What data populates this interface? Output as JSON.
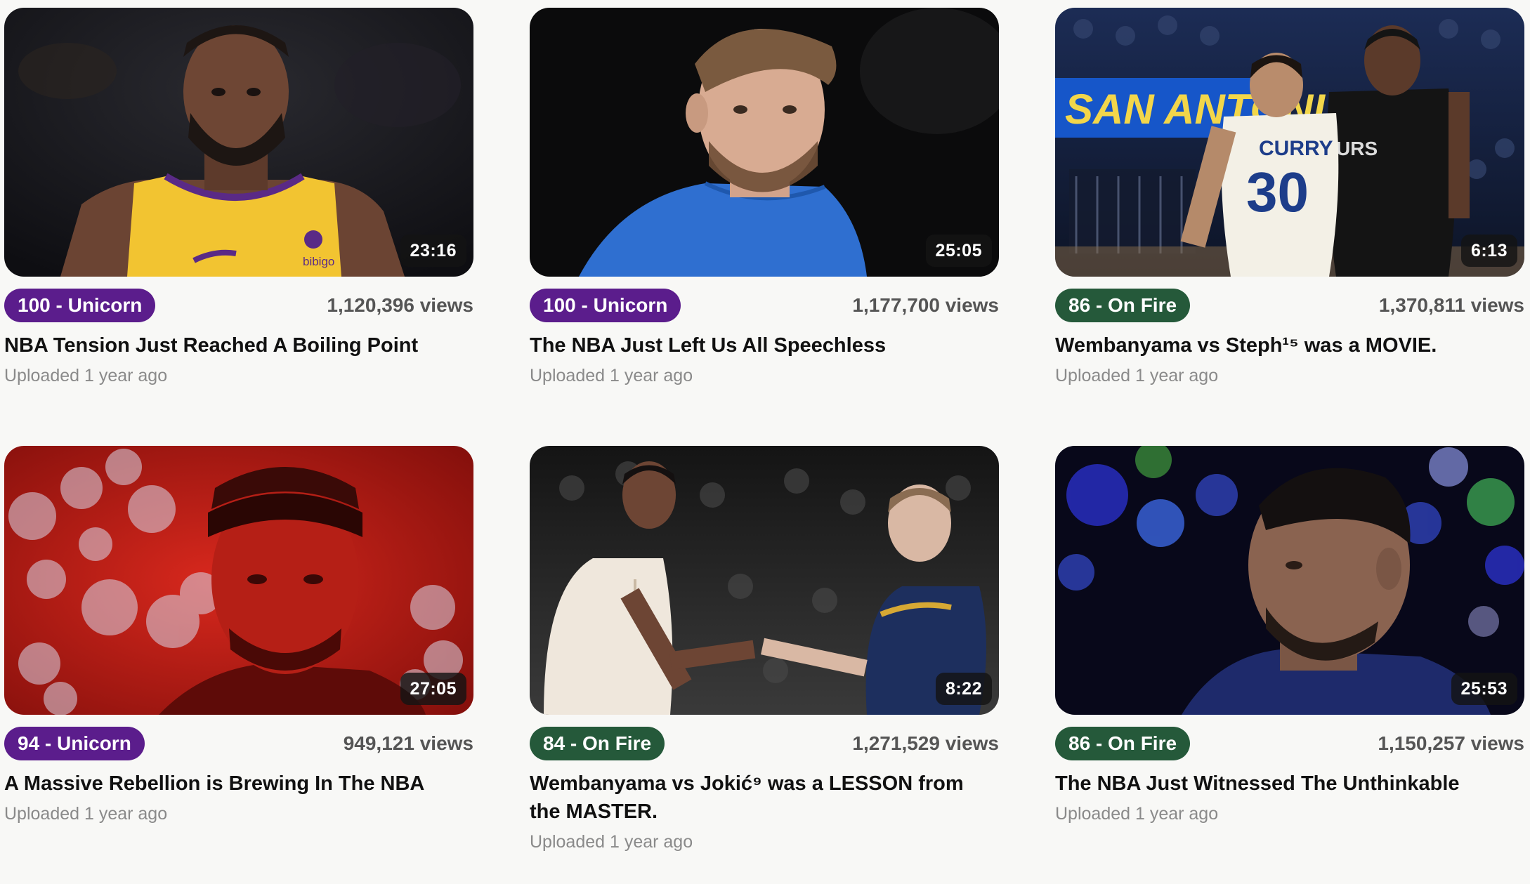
{
  "videos": [
    {
      "duration": "23:16",
      "badge": "100 - Unicorn",
      "badge_color": "#5b1d8c",
      "views": "1,120,396 views",
      "title": "NBA Tension Just Reached A Boiling Point",
      "uploaded": "Uploaded 1 year ago",
      "thumb_logo": "bibigo"
    },
    {
      "duration": "25:05",
      "badge": "100 - Unicorn",
      "badge_color": "#5b1d8c",
      "views": "1,177,700 views",
      "title": "The NBA Just Left Us All Speechless",
      "uploaded": "Uploaded 1 year ago"
    },
    {
      "duration": "6:13",
      "badge": "86 - On Fire",
      "badge_color": "#25593a",
      "views": "1,370,811 views",
      "title": "Wembanyama vs Steph¹⁵ was a MOVIE.",
      "uploaded": "Uploaded 1 year ago",
      "thumb_banner": "SAN ANTONI",
      "thumb_jersey_left": "CURRY",
      "thumb_number_left": "30",
      "thumb_jersey_right": "URS"
    },
    {
      "duration": "27:05",
      "badge": "94 - Unicorn",
      "badge_color": "#5b1d8c",
      "views": "949,121 views",
      "title": "A Massive Rebellion is Brewing In The NBA",
      "uploaded": "Uploaded 1 year ago"
    },
    {
      "duration": "8:22",
      "badge": "84 - On Fire",
      "badge_color": "#25593a",
      "views": "1,271,529 views",
      "title": "Wembanyama vs Jokić⁹ was a LESSON from the MASTER.",
      "uploaded": "Uploaded 1 year ago"
    },
    {
      "duration": "25:53",
      "badge": "86 - On Fire",
      "badge_color": "#25593a",
      "views": "1,150,257 views",
      "title": "The NBA Just Witnessed The Unthinkable",
      "uploaded": "Uploaded 1 year ago"
    }
  ]
}
